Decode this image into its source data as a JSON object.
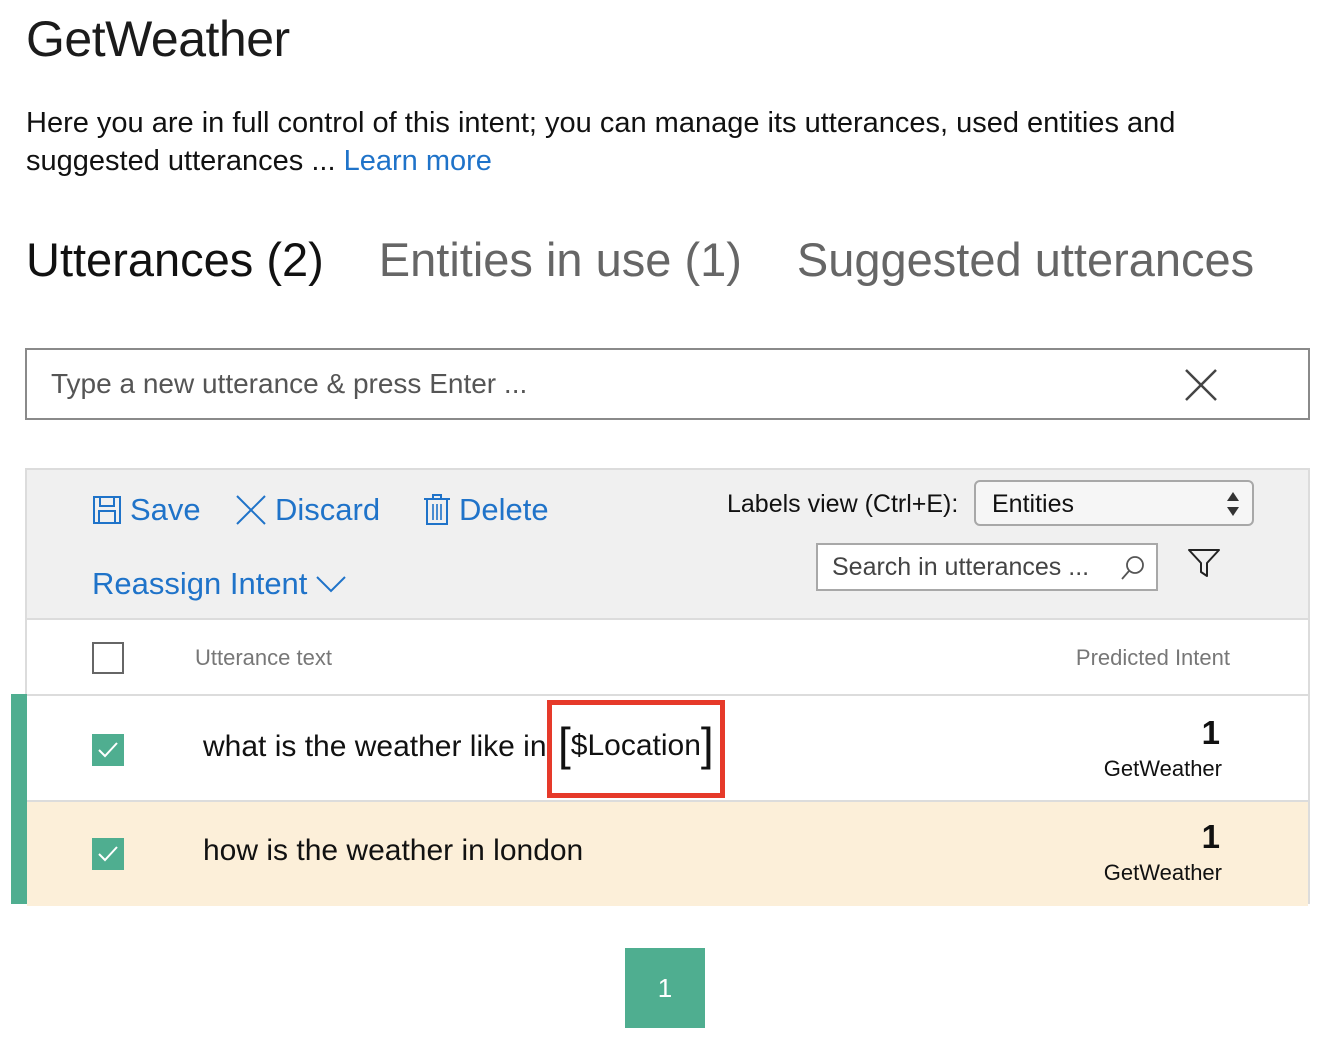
{
  "page": {
    "title": "GetWeather",
    "intro_text": "Here you are in full control of this intent; you can manage its utterances, used entities and suggested utterances ... ",
    "learn_more": "Learn more"
  },
  "tabs": [
    {
      "label": "Utterances (2)",
      "active": true
    },
    {
      "label": "Entities in use (1)",
      "active": false
    },
    {
      "label": "Suggested utterances",
      "active": false
    }
  ],
  "new_utterance": {
    "placeholder": "Type a new utterance & press Enter ..."
  },
  "toolbar": {
    "save_label": "Save",
    "discard_label": "Discard",
    "delete_label": "Delete",
    "reassign_label": "Reassign Intent",
    "labels_view_label": "Labels view (Ctrl+E):",
    "labels_view_value": "Entities",
    "search_placeholder": "Search in utterances ..."
  },
  "table": {
    "columns": {
      "utterance": "Utterance text",
      "predicted": "Predicted Intent"
    },
    "rows": [
      {
        "text": "what is the weather like in",
        "entity": "$Location",
        "score": "1",
        "intent": "GetWeather",
        "checked": true
      },
      {
        "text": "how is the weather in london",
        "score": "1",
        "intent": "GetWeather",
        "checked": true
      }
    ]
  },
  "pagination": {
    "current_page": "1"
  },
  "colors": {
    "accent_green": "#4fae90",
    "link_blue": "#1f73c9",
    "highlight_red": "#e63a2a",
    "row_highlight": "#fcefd9"
  }
}
